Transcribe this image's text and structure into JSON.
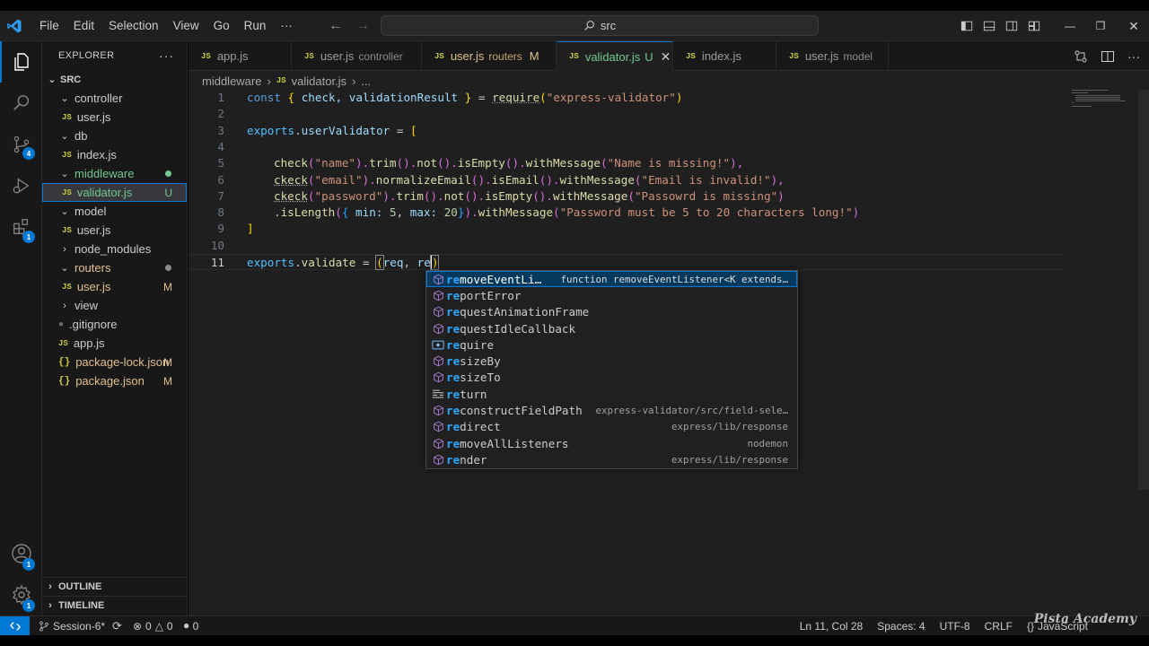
{
  "menu": [
    "File",
    "Edit",
    "Selection",
    "View",
    "Go",
    "Run",
    "···"
  ],
  "command_center": "src",
  "explorer": {
    "title": "EXPLORER",
    "root": "SRC",
    "items": [
      {
        "label": "controller",
        "type": "folder",
        "status": ""
      },
      {
        "label": "user.js",
        "type": "js",
        "status": ""
      },
      {
        "label": "db",
        "type": "folder",
        "status": ""
      },
      {
        "label": "index.js",
        "type": "js",
        "status": ""
      },
      {
        "label": "middleware",
        "type": "folder",
        "status": "dot"
      },
      {
        "label": "validator.js",
        "type": "js",
        "status": "U"
      },
      {
        "label": "model",
        "type": "folder",
        "status": ""
      },
      {
        "label": "user.js",
        "type": "js",
        "status": ""
      },
      {
        "label": "node_modules",
        "type": "folder-collapsed",
        "status": ""
      },
      {
        "label": "routers",
        "type": "folder",
        "status": "dot"
      },
      {
        "label": "user.js",
        "type": "js",
        "status": "M"
      },
      {
        "label": "view",
        "type": "folder-collapsed",
        "status": ""
      },
      {
        "label": ".gitignore",
        "type": "git",
        "status": ""
      },
      {
        "label": "app.js",
        "type": "js",
        "status": ""
      },
      {
        "label": "package-lock.json",
        "type": "json",
        "status": "M"
      },
      {
        "label": "package.json",
        "type": "json",
        "status": "M"
      }
    ],
    "outline": "OUTLINE",
    "timeline": "TIMELINE"
  },
  "tabs": [
    {
      "label": "app.js",
      "sub": "",
      "status": ""
    },
    {
      "label": "user.js",
      "sub": "controller",
      "status": ""
    },
    {
      "label": "user.js",
      "sub": "routers",
      "status": "M"
    },
    {
      "label": "validator.js",
      "sub": "",
      "status": "U"
    },
    {
      "label": "index.js",
      "sub": "",
      "status": ""
    },
    {
      "label": "user.js",
      "sub": "model",
      "status": ""
    }
  ],
  "breadcrumb": {
    "folder": "middleware",
    "file": "validator.js",
    "more": "..."
  },
  "code_lines": [
    "1",
    "2",
    "3",
    "4",
    "5",
    "6",
    "7",
    "8",
    "9",
    "10",
    "11"
  ],
  "code": {
    "l1": [
      "const",
      "{",
      "check,",
      "validationResult",
      "}",
      "=",
      "require",
      "(",
      "\"express-validator\"",
      ")"
    ],
    "l3": [
      "exports",
      ".",
      "userValidator",
      "=",
      "["
    ],
    "l5": [
      "check",
      "(",
      "\"name\"",
      ").",
      "trim",
      "().",
      "not",
      "().",
      "isEmpty",
      "().",
      "withMessage",
      "(",
      "\"Name is missing!\"",
      "),"
    ],
    "l6": [
      "ckeck",
      "(",
      "\"email\"",
      ").",
      "normalizeEmail",
      "().",
      "isEmail",
      "().",
      "withMessage",
      "(",
      "\"Email is invalid!\"",
      "),"
    ],
    "l7": [
      "ckeck",
      "(",
      "\"password\"",
      ").",
      "trim",
      "().",
      "not",
      "().",
      "isEmpty",
      "().",
      "withMessage",
      "(",
      "\"Passowrd is missing\"",
      ")"
    ],
    "l8": [
      ".",
      "isLength",
      "(",
      "{",
      "min:",
      "5",
      ",",
      "max:",
      "20",
      "}",
      ").",
      "withMessage",
      "(",
      "\"Password must be 5 to 20 characters long!\"",
      ")"
    ],
    "l9": [
      "]"
    ],
    "l11": [
      "exports",
      ".",
      "validate",
      "=",
      "(",
      "req",
      ",",
      "re",
      ")"
    ]
  },
  "suggestions": [
    {
      "match": "re",
      "rest": "moveEventLi…",
      "detail": "function removeEventListener<K extends…",
      "icon": "cube"
    },
    {
      "match": "re",
      "rest": "portError",
      "detail": "",
      "icon": "cube"
    },
    {
      "match": "re",
      "rest": "questAnimationFrame",
      "detail": "",
      "icon": "cube"
    },
    {
      "match": "re",
      "rest": "questIdleCallback",
      "detail": "",
      "icon": "cube"
    },
    {
      "match": "re",
      "rest": "quire",
      "detail": "",
      "icon": "variable"
    },
    {
      "match": "re",
      "rest": "sizeBy",
      "detail": "",
      "icon": "cube"
    },
    {
      "match": "re",
      "rest": "sizeTo",
      "detail": "",
      "icon": "cube"
    },
    {
      "match": "re",
      "rest": "turn",
      "detail": "",
      "icon": "keyword"
    },
    {
      "match": "re",
      "rest": "constructFieldPath",
      "detail": "express-validator/src/field-sele…",
      "icon": "cube"
    },
    {
      "match": "re",
      "rest": "direct",
      "detail": "express/lib/response",
      "icon": "cube"
    },
    {
      "match": "re",
      "rest": "moveAllListeners",
      "detail": "nodemon",
      "icon": "cube"
    },
    {
      "match": "re",
      "rest": "nder",
      "detail": "express/lib/response",
      "icon": "cube"
    }
  ],
  "statusbar": {
    "branch": "Session-6*",
    "errors": "0",
    "warnings": "0",
    "ports": "0",
    "position": "Ln 11, Col 28",
    "spaces": "Spaces: 4",
    "encoding": "UTF-8",
    "eol": "CRLF",
    "language": "JavaScript"
  },
  "badges": {
    "source_control": "4",
    "extensions": "1",
    "accounts": "1",
    "settings": "1"
  },
  "watermark": "Pista Academy",
  "colors": {
    "accent": "#0078d4",
    "modified": "#e2c08d",
    "untracked": "#73c991",
    "folder_dot_green": "#73c991",
    "folder_dot_gray": "#8b8b8b"
  }
}
